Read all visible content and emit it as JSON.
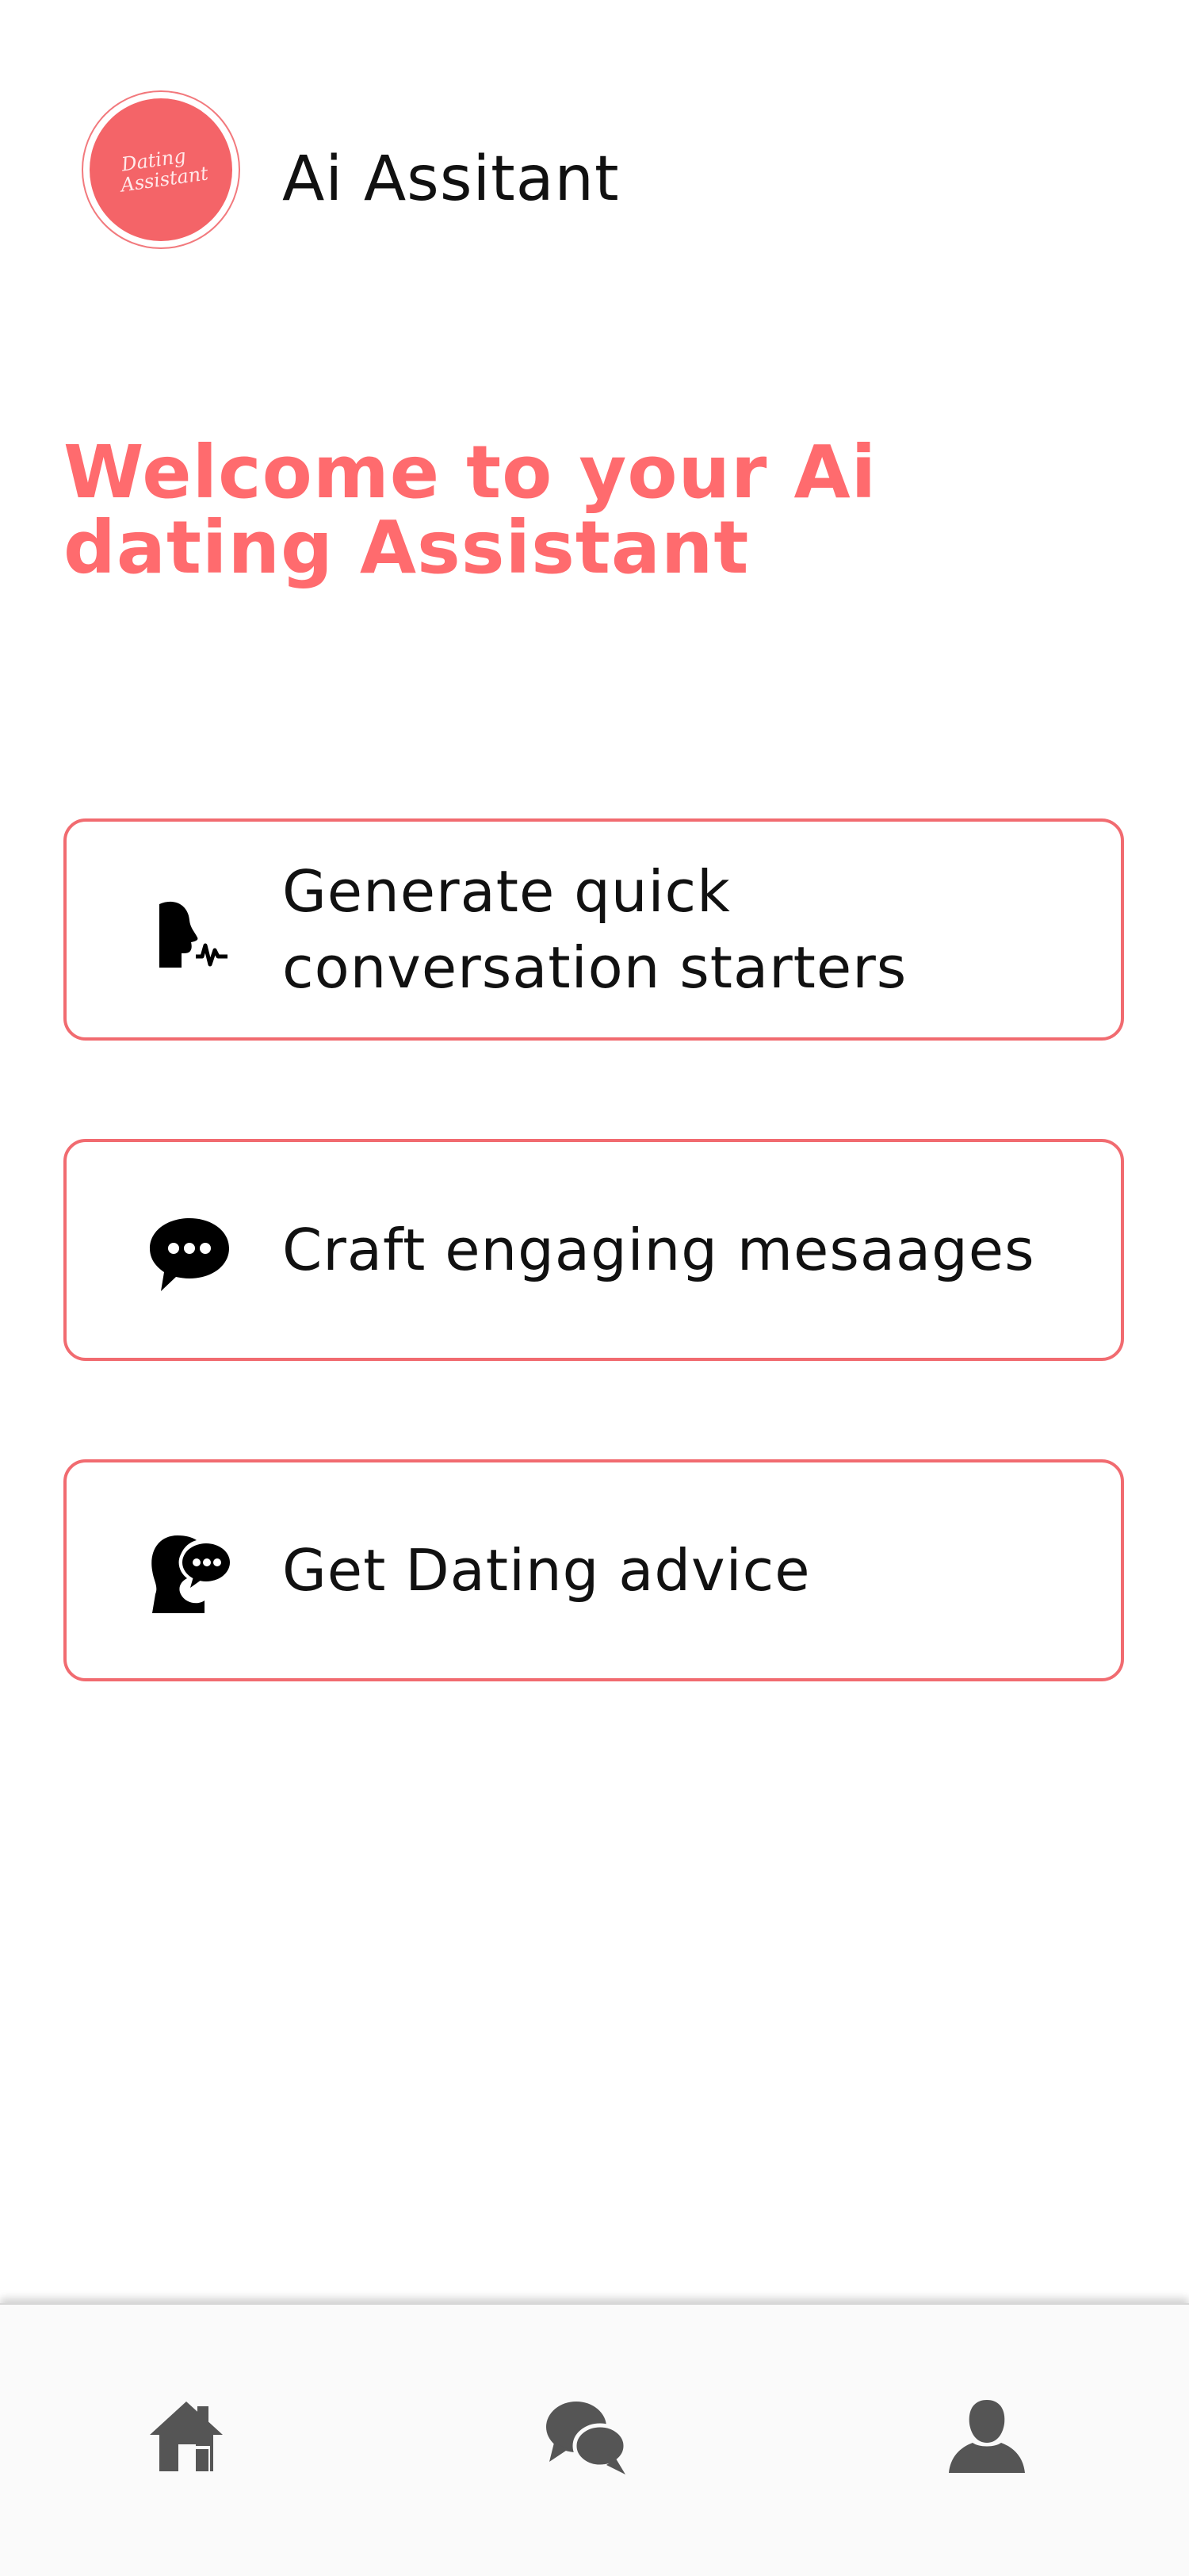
{
  "header": {
    "app_title": "Ai Assitant",
    "logo_text_line1": "Dating",
    "logo_text_line2": "Assistant"
  },
  "welcome": {
    "heading_line1": "Welcome to your Ai",
    "heading_line2": "dating Assistant"
  },
  "actions": [
    {
      "icon": "speaking-head-icon",
      "label_line1": "Generate quick",
      "label_line2": "conversation starters"
    },
    {
      "icon": "chat-bubble-icon",
      "label": "Craft engaging mesaages"
    },
    {
      "icon": "advice-person-icon",
      "label": "Get Dating advice"
    }
  ],
  "bottom_nav": [
    {
      "icon": "home-icon"
    },
    {
      "icon": "chats-icon"
    },
    {
      "icon": "profile-icon"
    }
  ],
  "colors": {
    "accent": "#ff6b6e",
    "card_border": "#f16b70",
    "logo_fill": "#f46468",
    "nav_icon": "#555555"
  }
}
